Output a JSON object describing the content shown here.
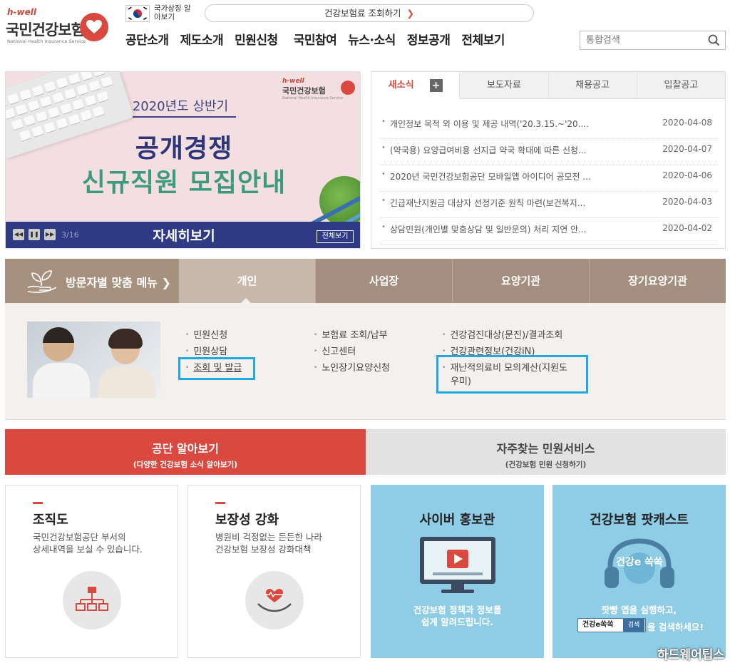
{
  "header": {
    "logo_small": "h-well",
    "logo_name": "국민건강보험",
    "logo_english": "National Health Insurance Service",
    "national_symbol_label": "국가상징 알아보기",
    "lookup_button": "건강보험료 조회하기",
    "nav": [
      "공단소개",
      "제도소개",
      "민원신청",
      "국민참여",
      "뉴스·소식",
      "정보공개",
      "전체보기"
    ],
    "search_placeholder": "통합검색"
  },
  "banner": {
    "logo_small": "h-well",
    "logo_name": "국민건강보험",
    "logo_english": "National Health Insurance Service",
    "subtitle": "2020년도 상반기",
    "title_line1": "공개경쟁",
    "title_line2": "신규직원 모집안내",
    "pager": "3/16",
    "detail_button": "자세히보기",
    "view_all_button": "전체보기"
  },
  "news": {
    "tabs": [
      "새소식",
      "보도자료",
      "채용공고",
      "입찰공고"
    ],
    "items": [
      {
        "title": "개인정보 목적 외 이용 및 제공 내역('20.3.15.~'20....",
        "date": "2020-04-08"
      },
      {
        "title": "(약국용) 요양급여비용 선지급 약국 확대에 따른 신청...",
        "date": "2020-04-07"
      },
      {
        "title": "2020년 국민건강보험공단 모바일앱 아이디어 공모전 ...",
        "date": "2020-04-06"
      },
      {
        "title": "긴급재난지원금 대상자 선정기준 원칙 마련(보건복지...",
        "date": "2020-04-03"
      },
      {
        "title": "상담민원(개인별 맞춤상담 및 일반문의) 처리 지연 안...",
        "date": "2020-04-02"
      }
    ]
  },
  "visitor_menu": {
    "heading": "방문자별 맞춤 메뉴",
    "tabs": [
      "개인",
      "사업장",
      "요양기관",
      "장기요양기관"
    ],
    "col1": [
      "민원신청",
      "민원상담",
      "조회 및 발급"
    ],
    "col2": [
      "보험료 조회/납부",
      "신고센터",
      "노인장기요양신청"
    ],
    "col3": [
      "건강검진대상(문진)/결과조회",
      "건강관련정보(건강iN)",
      "재난적의료비 모의계산(지원도",
      "우미)"
    ]
  },
  "section_tabs": {
    "left_title": "공단 알아보기",
    "left_sub": "(다양한 건강보험 소식 알아보기)",
    "right_title": "자주찾는 민원서비스",
    "right_sub": "(건강보험 민원 신청하기)"
  },
  "cards": [
    {
      "title": "조직도",
      "desc_1": "국민건강보험공단 부서의",
      "desc_2": "상세내역을 보실 수 있습니다."
    },
    {
      "title": "보장성 강화",
      "desc_1": "병원비 걱정없는 든든한 나라",
      "desc_2": "건강보험 보장성 강화대책"
    },
    {
      "title": "사이버 홍보관",
      "desc_1": "건강보험 정책과 정보를",
      "desc_2": "쉽게 알려드립니다."
    },
    {
      "title": "건강보험 팟캐스트",
      "desc_1": "팟빵 앱을 실행하고,",
      "search_box": "건강e쏙쏙",
      "search_btn": "검색",
      "desc_2": "을 검색하세요!",
      "badge": "건강e 쏙쏙"
    }
  ],
  "watermark": "하드웨어팁스",
  "colors": {
    "brand_red": "#d9493f",
    "banner_navy": "#2f3a85",
    "visitor_brown": "#a38e7f",
    "highlight_blue": "#1fa9e0",
    "card_blue": "#8fcde6"
  }
}
